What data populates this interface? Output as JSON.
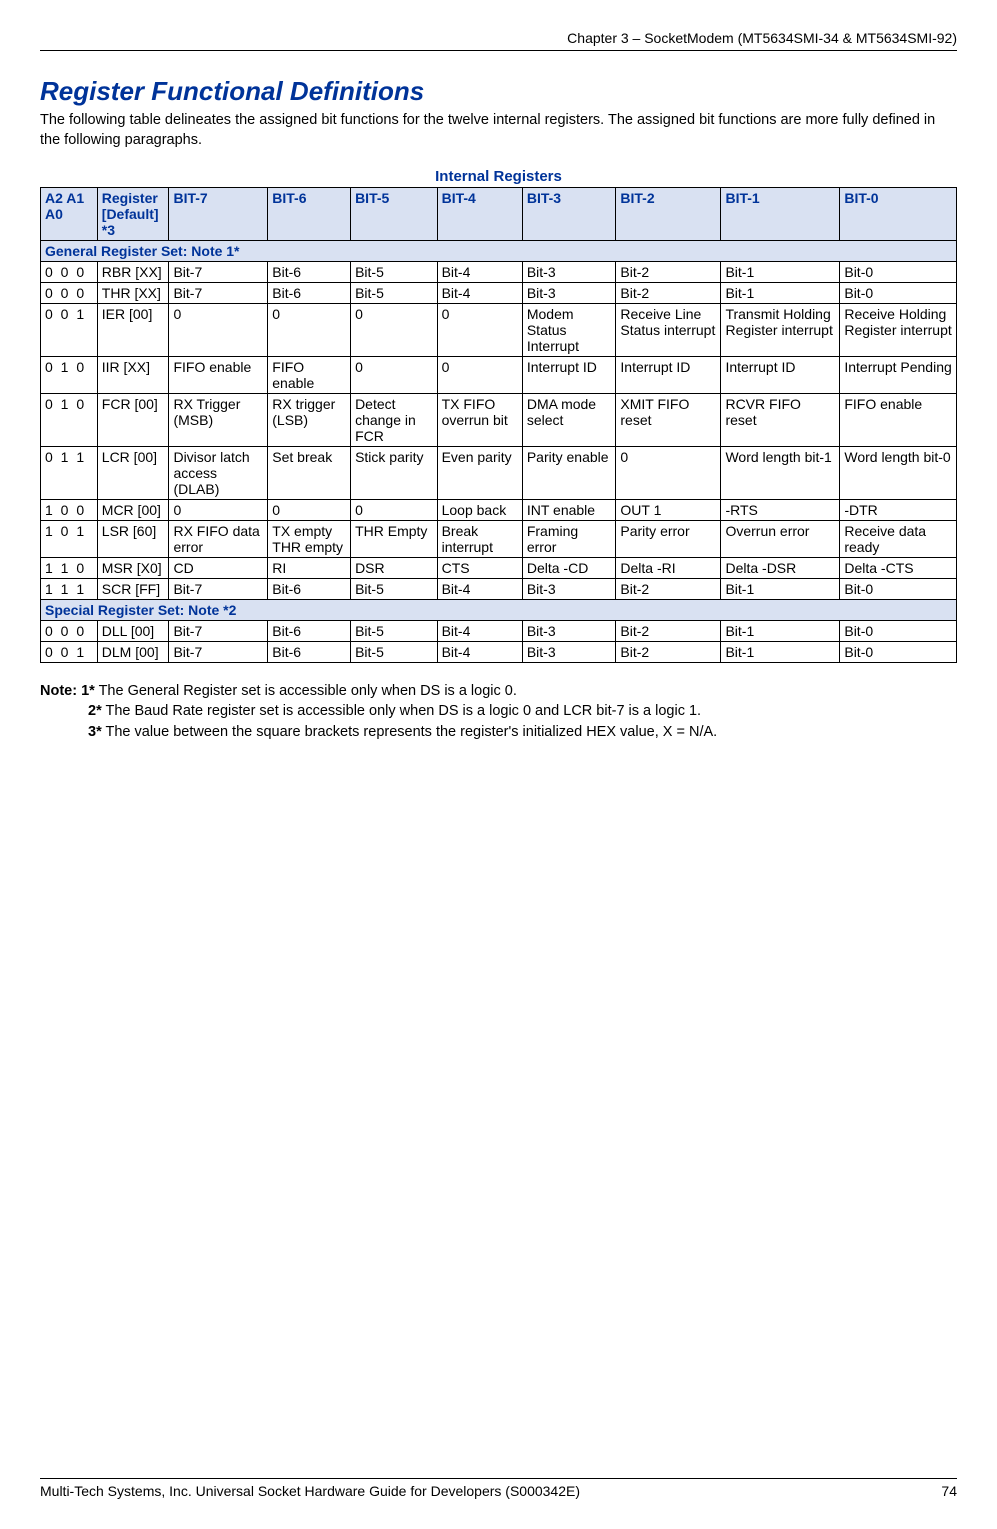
{
  "header": "Chapter 3 – SocketModem (MT5634SMI-34 & MT5634SMI-92)",
  "title": "Register Functional Definitions",
  "intro": "The following table delineates the assigned bit functions for the twelve internal registers. The assigned bit functions are more fully defined in the following paragraphs.",
  "table_title": "Internal Registers",
  "columns": {
    "c0_line1": "A2 A1 A0",
    "c1_line1": "Register",
    "c1_line2": "[Default]    *3",
    "bit7": "BIT-7",
    "bit6": "BIT-6",
    "bit5": "BIT-5",
    "bit4": "BIT-4",
    "bit3": "BIT-3",
    "bit2": "BIT-2",
    "bit1": "BIT-1",
    "bit0": "BIT-0"
  },
  "section1": "General Register Set: Note 1*",
  "section2": "Special Register Set:  Note *2",
  "rows": [
    {
      "addr": "0   0   0",
      "reg": "RBR [XX]",
      "b7": "Bit-7",
      "b6": "Bit-6",
      "b5": "Bit-5",
      "b4": "Bit-4",
      "b3": "Bit-3",
      "b2": "Bit-2",
      "b1": "Bit-1",
      "b0": "Bit-0"
    },
    {
      "addr": "0   0   0",
      "reg": "THR [XX]",
      "b7": "Bit-7",
      "b6": "Bit-6",
      "b5": "Bit-5",
      "b4": "Bit-4",
      "b3": "Bit-3",
      "b2": "Bit-2",
      "b1": "Bit-1",
      "b0": "Bit-0"
    },
    {
      "addr": "0   0   1",
      "reg": "IER [00]",
      "b7": "0",
      "b6": "0",
      "b5": "0",
      "b4": "0",
      "b3": "Modem Status Interrupt",
      "b2": "Receive Line Status interrupt",
      "b1": "Transmit Holding Register interrupt",
      "b0": "Receive Holding Register interrupt"
    },
    {
      "addr": "0   1   0",
      "reg": "IIR [XX]",
      "b7": "FIFO enable",
      "b6": "FIFO enable",
      "b5": "0",
      "b4": "0",
      "b3": "Interrupt ID",
      "b2": "Interrupt ID",
      "b1": "Interrupt ID",
      "b0": "Interrupt Pending"
    },
    {
      "addr": "0   1   0",
      "reg": "FCR [00]",
      "b7": "RX Trigger (MSB)",
      "b6": "RX trigger (LSB)",
      "b5": "Detect change in FCR",
      "b4": "TX FIFO overrun bit",
      "b3": "DMA mode select",
      "b2": "XMIT FIFO reset",
      "b1": "RCVR FIFO reset",
      "b0": "FIFO enable"
    },
    {
      "addr": "0   1   1",
      "reg": "LCR [00]",
      "b7": "Divisor latch access (DLAB)",
      "b6": "Set break",
      "b5": "Stick parity",
      "b4": "Even parity",
      "b3": "Parity enable",
      "b2": "  0",
      "b1": "Word length bit-1",
      "b0": "Word length bit-0"
    },
    {
      "addr": "1   0   0",
      "reg": "MCR [00]",
      "b7": "0",
      "b6": "0",
      "b5": "0",
      "b4": "Loop back",
      "b3": "INT enable",
      "b2": "OUT 1",
      "b1": "-RTS",
      "b0": "-DTR"
    },
    {
      "addr": "1   0   1",
      "reg": "LSR [60]",
      "b7": "RX FIFO data error",
      "b6": "TX empty THR empty",
      "b5": "THR Empty",
      "b4": "Break interrupt",
      "b3": "Framing error",
      "b2": "Parity error",
      "b1": "Overrun error",
      "b0": "Receive data ready"
    },
    {
      "addr": "1   1   0",
      "reg": "MSR [X0]",
      "b7": "CD",
      "b6": "RI",
      "b5": "DSR",
      "b4": "CTS",
      "b3": "Delta -CD",
      "b2": "Delta  -RI",
      "b1": "Delta -DSR",
      "b0": "Delta  -CTS"
    },
    {
      "addr": "1   1   1",
      "reg": "SCR [FF]",
      "b7": "Bit-7",
      "b6": "Bit-6",
      "b5": "Bit-5",
      "b4": "Bit-4",
      "b3": "Bit-3",
      "b2": "Bit-2",
      "b1": "Bit-1",
      "b0": "Bit-0"
    }
  ],
  "rows2": [
    {
      "addr": "0   0   0",
      "reg": "DLL [00]",
      "b7": "Bit-7",
      "b6": "Bit-6",
      "b5": "Bit-5",
      "b4": "Bit-4",
      "b3": "Bit-3",
      "b2": "Bit-2",
      "b1": "Bit-1",
      "b0": "Bit-0"
    },
    {
      "addr": "0   0   1",
      "reg": "DLM [00]",
      "b7": "Bit-7",
      "b6": "Bit-6",
      "b5": "Bit-5",
      "b4": "Bit-4",
      "b3": "Bit-3",
      "b2": "Bit-2",
      "b1": "Bit-1",
      "b0": "Bit-0"
    }
  ],
  "notes": {
    "label": "Note:",
    "n1_pre": "1*",
    "n1": " The General Register set is accessible only when DS is a logic 0.",
    "n2_pre": "2*",
    "n2": " The Baud Rate register set is accessible only when DS is a logic 0 and LCR bit-7 is a logic 1.",
    "n3_pre": "3*",
    "n3": " The value between the square brackets represents the register's initialized HEX value, X = N/A."
  },
  "footer_left": "Multi-Tech Systems, Inc. Universal Socket Hardware Guide for Developers (S000342E)",
  "footer_right": "74"
}
